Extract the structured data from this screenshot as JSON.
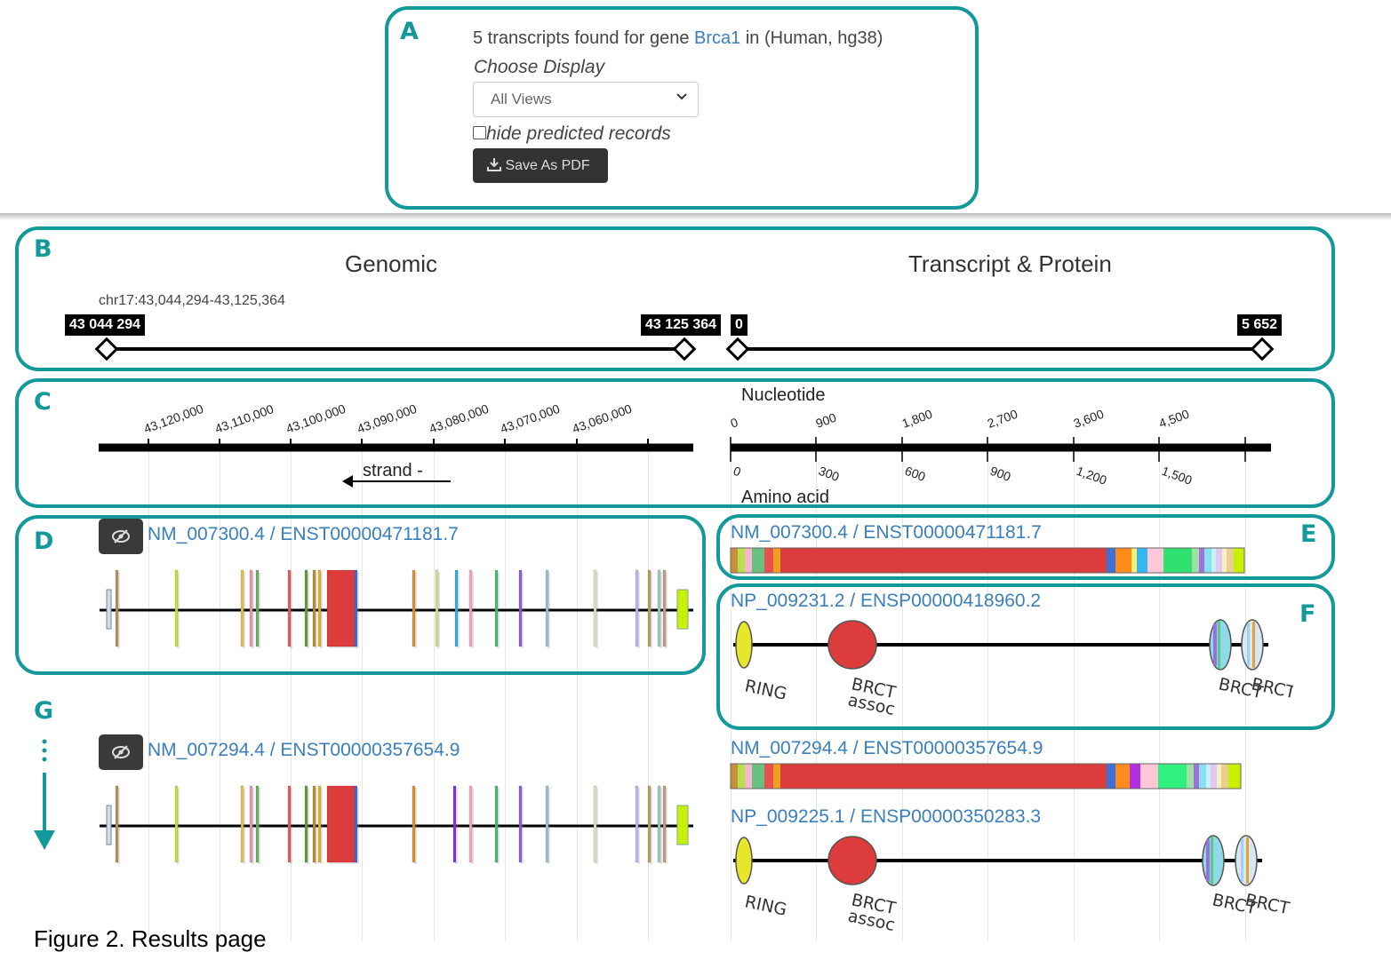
{
  "panel_a": {
    "summary_prefix": "5 transcripts found for gene ",
    "gene": "Brca1",
    "summary_suffix": " in (Human, hg38)",
    "choose_display": "Choose Display",
    "select_value": "All Views",
    "checkbox_label": "hide predicted records",
    "save_pdf_label": "Save As PDF"
  },
  "letters": {
    "a": "A",
    "b": "B",
    "c": "C",
    "d": "D",
    "e": "E",
    "f": "F",
    "g": "G"
  },
  "panel_b": {
    "genomic_title": "Genomic",
    "transcript_title": "Transcript & Protein",
    "coords": "chr17:43,044,294-43,125,364",
    "g_start": "43 044 294",
    "g_end": "43 125 364",
    "t_start": "0",
    "t_end": "5 652"
  },
  "panel_c": {
    "genomic_ticks": [
      "43,120,000",
      "43,110,000",
      "43,100,000",
      "43,090,000",
      "43,080,000",
      "43,070,000",
      "43,060,000"
    ],
    "strand_label": "strand -",
    "nucleotide_label": "Nucleotide",
    "nucleotide_ticks": [
      "0",
      "900",
      "1,800",
      "2,700",
      "3,600",
      "4,500"
    ],
    "aa_label": "Amino acid",
    "aa_ticks": [
      "0",
      "300",
      "600",
      "900",
      "1,200",
      "1,500"
    ]
  },
  "records": [
    {
      "transcript_id": "NM_007300.4 / ENST00000471181.7",
      "protein_id": "NP_009231.2 / ENSP00000418960.2"
    },
    {
      "transcript_id": "NM_007294.4 / ENST00000357654.9",
      "protein_id": "NP_009225.1 / ENSP00000350283.3"
    }
  ],
  "domains": {
    "ring": "RING",
    "brct_assoc_1": "BRCT",
    "brct_assoc_2": "assoc",
    "brct": "BRCT"
  },
  "caption": "Figure 2. Results page",
  "colors": {
    "teal": "#13999a",
    "link": "#3a7fbd",
    "exon_red": "#dd3c3c",
    "domain_yellow": "#e6e62a"
  }
}
